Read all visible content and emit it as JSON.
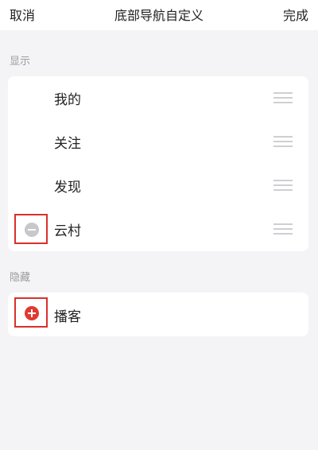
{
  "header": {
    "cancel_label": "取消",
    "title": "底部导航自定义",
    "done_label": "完成"
  },
  "shown_section": {
    "label": "显示",
    "items": [
      {
        "label": "我的",
        "icon": "drag-handle-icon"
      },
      {
        "label": "关注",
        "icon": "drag-handle-icon"
      },
      {
        "label": "发现",
        "icon": "drag-handle-icon"
      },
      {
        "label": "云村",
        "icon": "drag-handle-icon",
        "action_icon": "remove-icon"
      }
    ]
  },
  "hidden_section": {
    "label": "隐藏",
    "items": [
      {
        "label": "播客",
        "action_icon": "add-icon"
      }
    ]
  },
  "colors": {
    "accent_red": "#e03a30",
    "highlight_border": "#d9302b",
    "background": "#f4f4f6",
    "card": "#ffffff"
  }
}
